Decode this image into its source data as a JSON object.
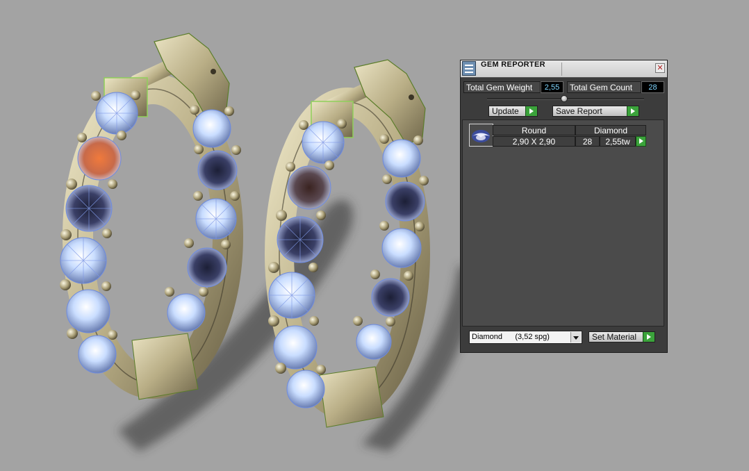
{
  "window": {
    "title": "GEM REPORTER",
    "close_symbol": "✕"
  },
  "stats": {
    "weight_label": "Total Gem Weight",
    "weight_value": "2,55",
    "count_label": "Total Gem Count",
    "count_value": "28"
  },
  "actions": {
    "update_label": "Update",
    "save_report_label": "Save Report",
    "set_material_label": "Set Material"
  },
  "gem_list": {
    "rows": [
      {
        "thumb_icon": "round-gem-icon",
        "shape": "Round",
        "material": "Diamond",
        "size": "2,90 X 2,90",
        "count": "28",
        "weight": "2,55tw"
      }
    ]
  },
  "material_select": {
    "selected": "Diamond      (3,52 spg)"
  },
  "icons": [
    "app-icon",
    "close-icon",
    "play-arrow-icon",
    "round-gem-icon",
    "chevron-down-icon"
  ],
  "colors": {
    "viewport_bg": "#a3a3a3",
    "panel_bg": "#3c3c3c",
    "value_text": "#7fd6ff",
    "accent_green": "#3ba33b",
    "metal_gold": "#c9c0a0",
    "gem_blue": "#c9ddff"
  }
}
